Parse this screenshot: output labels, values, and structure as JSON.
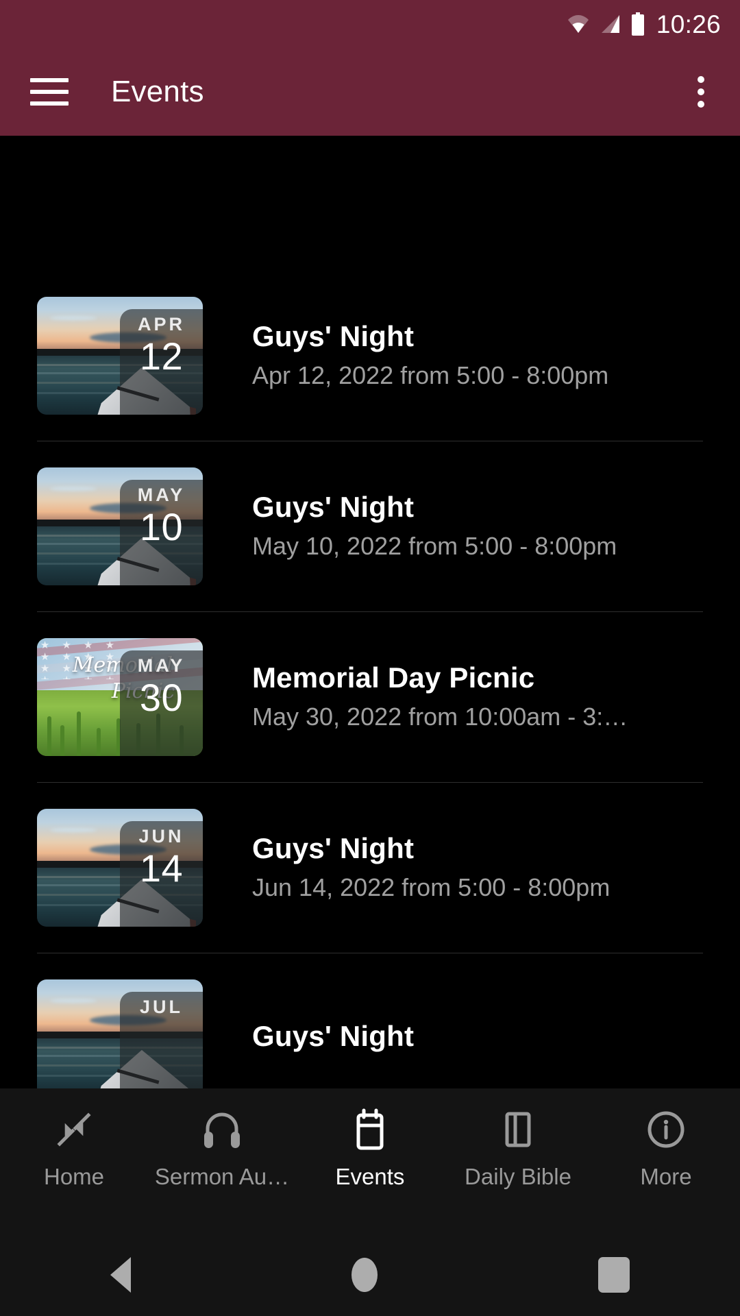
{
  "status_bar": {
    "time": "10:26",
    "icons": [
      "wifi-icon",
      "cell-signal-icon",
      "battery-icon"
    ]
  },
  "app_bar": {
    "menu_icon": "hamburger-menu-icon",
    "title": "Events",
    "overflow_icon": "more-vertical-icon",
    "background_color": "#6B2438"
  },
  "events": [
    {
      "month": "APR",
      "day": "12",
      "title": "Guys' Night",
      "subtitle": "Apr 12, 2022 from 5:00 - 8:00pm",
      "artwork": "lake-kayak-sunset"
    },
    {
      "month": "MAY",
      "day": "10",
      "title": "Guys' Night",
      "subtitle": "May 10, 2022 from 5:00 - 8:00pm",
      "artwork": "lake-kayak-sunset"
    },
    {
      "month": "MAY",
      "day": "30",
      "title": "Memorial Day Picnic",
      "subtitle": "May 30, 2022 from 10:00am - 3:…",
      "artwork": "memorial-day-flag-grass",
      "artwork_text_line1": "Memorial",
      "artwork_text_line2": "Picnic"
    },
    {
      "month": "JUN",
      "day": "14",
      "title": "Guys' Night",
      "subtitle": "Jun 14, 2022 from 5:00 - 8:00pm",
      "artwork": "lake-kayak-sunset"
    },
    {
      "month": "JUL",
      "day": "",
      "title": "Guys' Night",
      "subtitle": "",
      "artwork": "lake-kayak-sunset"
    }
  ],
  "bottom_nav": {
    "items": [
      {
        "label": "Home",
        "icon": "arrows-collapse-icon",
        "active": false
      },
      {
        "label": "Sermon Au…",
        "icon": "headphones-icon",
        "active": false
      },
      {
        "label": "Events",
        "icon": "calendar-icon",
        "active": true
      },
      {
        "label": "Daily Bible",
        "icon": "book-icon",
        "active": false
      },
      {
        "label": "More",
        "icon": "info-circle-icon",
        "active": false
      }
    ],
    "active_color": "#ffffff",
    "inactive_color": "#9a9a9a"
  },
  "system_nav": {
    "back_icon": "triangle-back-icon",
    "home_icon": "circle-home-icon",
    "recents_icon": "square-recents-icon"
  }
}
